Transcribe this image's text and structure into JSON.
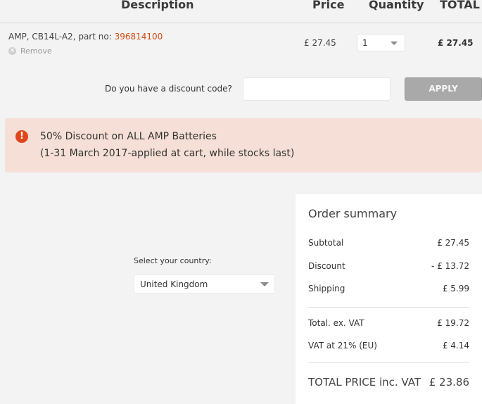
{
  "table": {
    "headers": {
      "description": "Description",
      "price": "Price",
      "quantity": "Quantity",
      "total": "TOTAL"
    },
    "items": [
      {
        "name_prefix": "AMP, CB14L-A2, part no: ",
        "part_no": "396814100",
        "remove_label": "Remove",
        "price": "£ 27.45",
        "quantity": "1",
        "total": "£ 27.45"
      }
    ]
  },
  "discount": {
    "label": "Do you have a discount code?",
    "input_value": "",
    "placeholder": "",
    "apply_label": "APPLY"
  },
  "promo": {
    "icon": "exclamation-icon",
    "line1": "50% Discount on ALL AMP Batteries",
    "line2": "(1-31 March 2017-applied at cart, while stocks last)"
  },
  "country": {
    "label": "Select your country:",
    "selected": "United Kingdom"
  },
  "summary": {
    "title": "Order summary",
    "subtotal_label": "Subtotal",
    "subtotal_value": "£ 27.45",
    "discount_label": "Discount",
    "discount_value": "- £ 13.72",
    "shipping_label": "Shipping",
    "shipping_value": "£ 5.99",
    "exvat_label": "Total. ex. VAT",
    "exvat_value": "£ 19.72",
    "vat_label": "VAT at 21% (EU)",
    "vat_value": "£ 4.14",
    "total_label": "TOTAL PRICE inc. VAT",
    "total_value": "£ 23.86"
  },
  "colors": {
    "accent": "#d34a16",
    "promo_bg": "#f5dfd6",
    "promo_icon": "#e0461b",
    "apply_button": "#a9a9a9"
  }
}
